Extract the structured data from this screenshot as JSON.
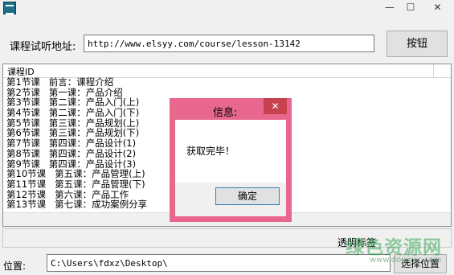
{
  "window": {
    "min_glyph": "—",
    "max_glyph": "☐",
    "close_glyph": "✕"
  },
  "form": {
    "url_label": "课程试听地址:",
    "url_value": "http://www.elsyy.com/course/lesson-13142",
    "go_button": "按钮"
  },
  "list": {
    "column_header": "课程ID",
    "rows": [
      "第1节课   前言：课程介绍",
      "第2节课   第一课：产品介绍",
      "第3节课   第二课：产品入门(上)",
      "第4节课   第二课：产品入门(下)",
      "第5节课   第三课：产品规划(上)",
      "第6节课   第三课：产品规划(下)",
      "第7节课   第四课：产品设计(1)",
      "第8节课   第四课：产品设计(2)",
      "第9节课   第四课：产品设计(3)",
      "第10节课   第五课：产品管理(上)",
      "第11节课   第五课：产品管理(下)",
      "第12节课   第六课：产品工作",
      "第13节课   第七课：成功案例分享"
    ]
  },
  "status": {
    "opacity_label": "透明标签"
  },
  "path": {
    "label": "位置:",
    "value": "C:\\Users\\fdxz\\Desktop\\",
    "choose_button": "选择位置"
  },
  "dialog": {
    "title": "信息:",
    "close_glyph": "✕",
    "message": "获取完毕！",
    "ok_button": "确定"
  },
  "watermark": {
    "brand": "绿色资源网",
    "url": "www.downcc.com"
  },
  "colors": {
    "dialog_frame": "#e8688d",
    "dialog_close": "#c7414e"
  }
}
